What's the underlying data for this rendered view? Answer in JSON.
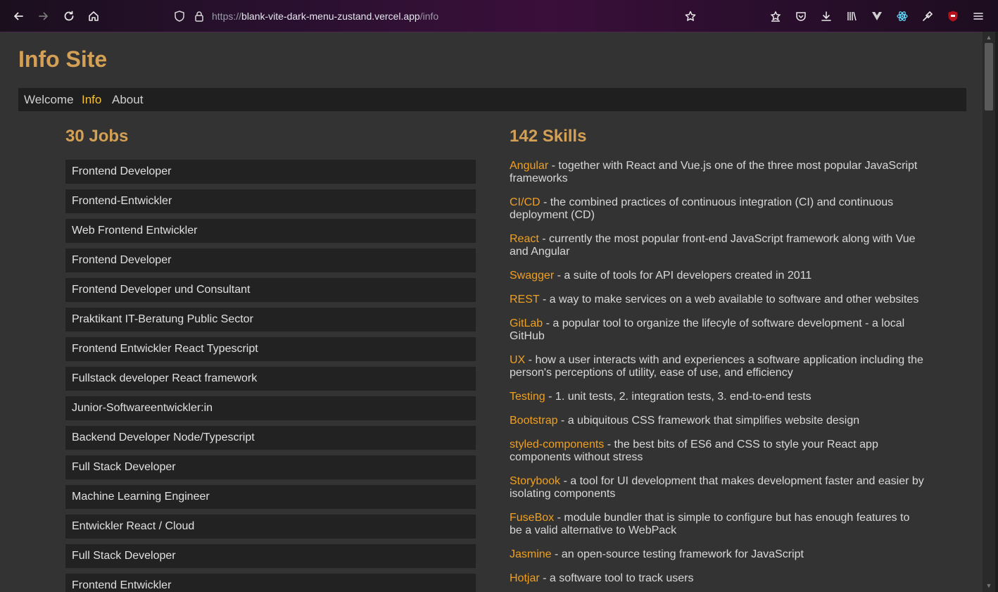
{
  "browser": {
    "url_scheme": "https://",
    "url_host": "blank-vite-dark-menu-zustand.vercel.app",
    "url_path": "/info"
  },
  "site": {
    "title": "Info Site"
  },
  "nav": {
    "items": [
      {
        "label": "Welcome",
        "active": false
      },
      {
        "label": "Info",
        "active": true
      },
      {
        "label": "About",
        "active": false
      }
    ]
  },
  "jobs": {
    "title": "30 Jobs",
    "items": [
      "Frontend Developer",
      "Frontend-Entwickler",
      "Web Frontend Entwickler",
      "Frontend Developer",
      "Frontend Developer und Consultant",
      "Praktikant IT-Beratung Public Sector",
      "Frontend Entwickler React Typescript",
      "Fullstack developer React framework",
      "Junior-Softwareentwickler:in",
      "Backend Developer Node/Typescript",
      "Full Stack Developer",
      "Machine Learning Engineer",
      "Entwickler React / Cloud",
      "Full Stack Developer",
      "Frontend Entwickler"
    ]
  },
  "skills": {
    "title": "142 Skills",
    "items": [
      {
        "name": "Angular",
        "desc": " - together with React and Vue.js one of the three most popular JavaScript frameworks"
      },
      {
        "name": "CI/CD",
        "desc": " - the combined practices of continuous integration (CI) and continuous deployment (CD)"
      },
      {
        "name": "React",
        "desc": " - currently the most popular front-end JavaScript framework along with Vue and Angular"
      },
      {
        "name": "Swagger",
        "desc": " - a suite of tools for API developers created in 2011"
      },
      {
        "name": "REST",
        "desc": " - a way to make services on a web available to software and other websites"
      },
      {
        "name": "GitLab",
        "desc": " - a popular tool to organize the lifecyle of software development - a local GitHub"
      },
      {
        "name": "UX",
        "desc": " - how a user interacts with and experiences a software application including the person's perceptions of utility, ease of use, and efficiency"
      },
      {
        "name": "Testing",
        "desc": " - 1. unit tests, 2. integration tests, 3. end-to-end tests"
      },
      {
        "name": "Bootstrap",
        "desc": " - a ubiquitous CSS framework that simplifies website design"
      },
      {
        "name": "styled-components",
        "desc": " - the best bits of ES6 and CSS to style your React app components without stress"
      },
      {
        "name": "Storybook",
        "desc": " - a tool for UI development that makes development faster and easier by isolating components"
      },
      {
        "name": "FuseBox",
        "desc": " - module bundler that is simple to configure but has enough features to be a valid alternative to WebPack"
      },
      {
        "name": "Jasmine",
        "desc": " - an open-source testing framework for JavaScript"
      },
      {
        "name": "Hotjar",
        "desc": " - a software tool to track users"
      }
    ]
  },
  "colors": {
    "accent_title": "#d4a055",
    "skill_name": "#f0a020",
    "nav_active": "#f3c13a",
    "page_bg": "#333333",
    "item_bg": "#222222"
  }
}
